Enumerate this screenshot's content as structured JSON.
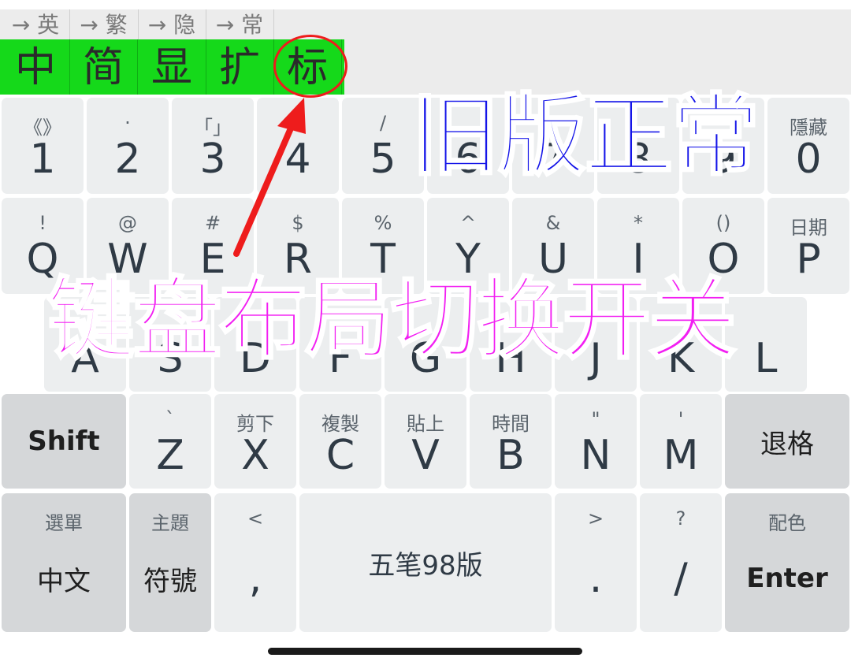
{
  "toolbar": {
    "top_labels": [
      "→ 英",
      "→ 繁",
      "→ 隐",
      "→ 常"
    ],
    "main_labels": [
      "中",
      "简",
      "显",
      "扩",
      "标"
    ]
  },
  "rows": {
    "numbers": [
      {
        "sub": "《》",
        "main": "1"
      },
      {
        "sub": "·",
        "main": "2"
      },
      {
        "sub": "「」",
        "main": "3"
      },
      {
        "sub": "",
        "main": "4"
      },
      {
        "sub": "/",
        "main": "5"
      },
      {
        "sub": "",
        "main": "6"
      },
      {
        "sub": "",
        "main": "7"
      },
      {
        "sub": "",
        "main": "8"
      },
      {
        "sub": "",
        "main": "9"
      },
      {
        "sub": "隱藏",
        "main": "0"
      }
    ],
    "qwerty": [
      {
        "sub": "!",
        "main": "Q"
      },
      {
        "sub": "@",
        "main": "W"
      },
      {
        "sub": "#",
        "main": "E"
      },
      {
        "sub": "$",
        "main": "R"
      },
      {
        "sub": "%",
        "main": "T"
      },
      {
        "sub": "^",
        "main": "Y"
      },
      {
        "sub": "&",
        "main": "U"
      },
      {
        "sub": "*",
        "main": "I"
      },
      {
        "sub": "()",
        "main": "O"
      },
      {
        "sub": "日期",
        "main": "P"
      }
    ],
    "home": [
      {
        "sub": "",
        "main": "A"
      },
      {
        "sub": "",
        "main": "S"
      },
      {
        "sub": "",
        "main": "D"
      },
      {
        "sub": "",
        "main": "F"
      },
      {
        "sub": "",
        "main": "G"
      },
      {
        "sub": "",
        "main": "H"
      },
      {
        "sub": "",
        "main": "J"
      },
      {
        "sub": "",
        "main": "K"
      },
      {
        "sub": "",
        "main": "L"
      }
    ],
    "bottom": [
      {
        "sub": "`",
        "main": "Z"
      },
      {
        "sub": "剪下",
        "main": "X"
      },
      {
        "sub": "複製",
        "main": "C"
      },
      {
        "sub": "貼上",
        "main": "V"
      },
      {
        "sub": "時間",
        "main": "B"
      },
      {
        "sub": "\"",
        "main": "N"
      },
      {
        "sub": "'",
        "main": "M"
      }
    ]
  },
  "keys": {
    "shift": "Shift",
    "backspace": "退格",
    "menu_sub": "選單",
    "menu_main": "中文",
    "theme_sub": "主題",
    "symbols_main": "符號",
    "comma_sub": "<",
    "comma_main": ",",
    "space": "五笔98版",
    "period_sub": ">",
    "period_main": ".",
    "slash_sub": "?",
    "slash_main": "/",
    "color_sub": "配色",
    "enter": "Enter"
  },
  "overlays": {
    "title_blue": "旧版正常",
    "title_magenta": "键盘布局切换开关"
  },
  "colors": {
    "highlight_green": "#15d91a",
    "annotation_red": "#ee1c1c",
    "overlay_blue": "#1414e8",
    "overlay_magenta": "#f21ef2"
  }
}
